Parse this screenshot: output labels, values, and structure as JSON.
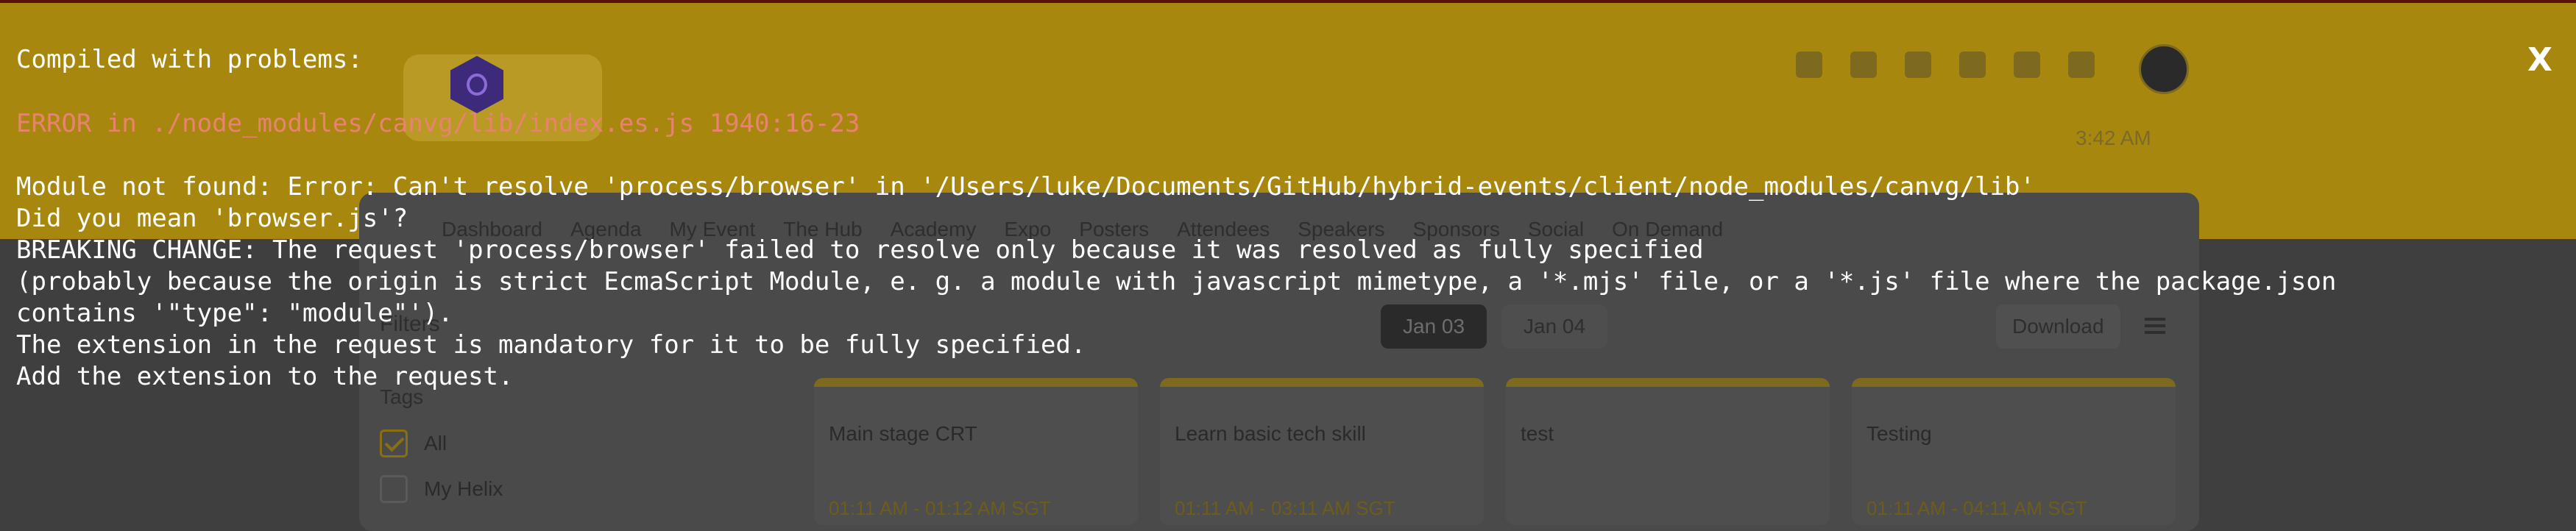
{
  "app": {
    "clock": "3:42 AM",
    "nav": [
      "Dashboard",
      "Agenda",
      "My Event",
      "The Hub",
      "Academy",
      "Expo",
      "Posters",
      "Attendees",
      "Speakers",
      "Sponsors",
      "Social",
      "On Demand"
    ],
    "filters_title": "Filters",
    "tags_title": "Tags",
    "tags": [
      {
        "label": "All",
        "checked": true
      },
      {
        "label": "My Helix",
        "checked": false
      }
    ],
    "dates": [
      "Jan 03",
      "Jan 04"
    ],
    "download_label": "Download",
    "sessions": [
      {
        "title": "Main stage CRT",
        "time": "01:11 AM - 01:12 AM SGT"
      },
      {
        "title": "Learn basic tech skill",
        "time": "01:11 AM - 03:11 AM SGT"
      },
      {
        "title": "test",
        "time": ""
      },
      {
        "title": "Testing",
        "time": "01:11 AM - 04:11 AM SGT"
      }
    ]
  },
  "overlay": {
    "heading": "Compiled with problems:",
    "error_location": "ERROR in ./node_modules/canvg/lib/index.es.js 1940:16-23",
    "message_lines": [
      "Module not found: Error: Can't resolve 'process/browser' in '/Users/luke/Documents/GitHub/hybrid-events/client/node_modules/canvg/lib'",
      "Did you mean 'browser.js'?",
      "BREAKING CHANGE: The request 'process/browser' failed to resolve only because it was resolved as fully specified",
      "(probably because the origin is strict EcmaScript Module, e. g. a module with javascript mimetype, a '*.mjs' file, or a '*.js' file where the package.json",
      "contains '\"type\": \"module\"').",
      "The extension in the request is mandatory for it to be fully specified.",
      "Add the extension to the request."
    ],
    "close_label": "X"
  }
}
